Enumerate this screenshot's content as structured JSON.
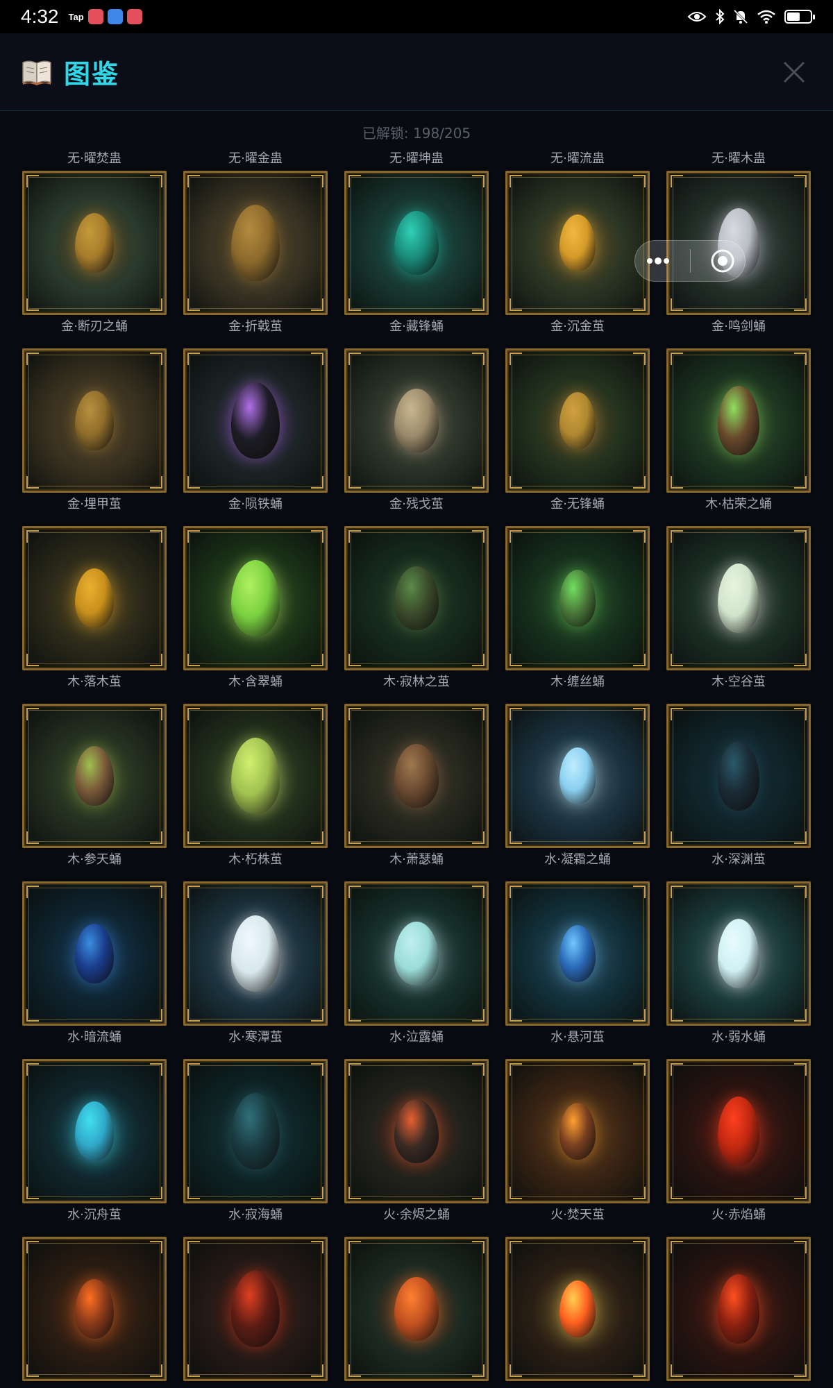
{
  "status_bar": {
    "time": "4:32",
    "tap_label": "Tap",
    "app_icon_colors": [
      "#e34f5a",
      "#3f86e8",
      "#e34f5a"
    ],
    "icons": [
      "eye-icon",
      "bluetooth-icon",
      "bell-muted-icon",
      "wifi-icon",
      "battery-icon"
    ]
  },
  "header": {
    "title": "图鉴",
    "icon": "book-icon",
    "close_icon": "close-icon"
  },
  "progress": {
    "text": "已解锁: 198/205"
  },
  "top_row_names": [
    "无·曜焚蛊",
    "无·曜金蛊",
    "无·曜坤蛊",
    "无·曜流蛊",
    "无·曜木蛊"
  ],
  "items": [
    {
      "name": "金·断刃之蛹",
      "bg": "#2a3a2c",
      "glow": "#c49a3a",
      "egg": "#a67c2c"
    },
    {
      "name": "金·折戟茧",
      "bg": "#3a3424",
      "glow": "#b48a40",
      "egg": "#8c6a2c"
    },
    {
      "name": "金·藏锋蛹",
      "bg": "#183830",
      "glow": "#2fd0b8",
      "egg": "#1a8a78"
    },
    {
      "name": "金·沉金茧",
      "bg": "#2c3624",
      "glow": "#f0b840",
      "egg": "#d49a28"
    },
    {
      "name": "金·鸣剑蛹",
      "bg": "#24302a",
      "glow": "#d8dce0",
      "egg": "#b8bcc4"
    },
    {
      "name": "金·埋甲茧",
      "bg": "#3a3220",
      "glow": "#b89040",
      "egg": "#8e6c2a"
    },
    {
      "name": "金·陨铁蛹",
      "bg": "#1c2426",
      "glow": "#b070e8",
      "egg": "#1c1c24"
    },
    {
      "name": "金·残戈茧",
      "bg": "#2a3428",
      "glow": "#c8b690",
      "egg": "#9a8a6a"
    },
    {
      "name": "金·无锋蛹",
      "bg": "#22321e",
      "glow": "#d0a040",
      "egg": "#b08830"
    },
    {
      "name": "木·枯荣之蛹",
      "bg": "#1c3420",
      "glow": "#8ee060",
      "egg": "#6a4a2c"
    },
    {
      "name": "木·落木茧",
      "bg": "#2c2a1a",
      "glow": "#e8b030",
      "egg": "#c8901c"
    },
    {
      "name": "木·含翠蛹",
      "bg": "#1c3418",
      "glow": "#b0f060",
      "egg": "#7ad040"
    },
    {
      "name": "木·寂林之茧",
      "bg": "#162a1c",
      "glow": "#5a8a4a",
      "egg": "#3a4a2a"
    },
    {
      "name": "木·缠丝蛹",
      "bg": "#16301c",
      "glow": "#70e060",
      "egg": "#4a7a3a"
    },
    {
      "name": "木·空谷茧",
      "bg": "#1c2e26",
      "glow": "#e8f4e0",
      "egg": "#d0e4cc"
    },
    {
      "name": "木·参天蛹",
      "bg": "#243020",
      "glow": "#a0c050",
      "egg": "#7a5a3a"
    },
    {
      "name": "木·朽株茧",
      "bg": "#22301c",
      "glow": "#d0f070",
      "egg": "#a0c050"
    },
    {
      "name": "木·萧瑟蛹",
      "bg": "#26281e",
      "glow": "#a07850",
      "egg": "#6a4a30"
    },
    {
      "name": "水·凝霜之蛹",
      "bg": "#1a3240",
      "glow": "#c0ecff",
      "egg": "#8ad0f0"
    },
    {
      "name": "水·深渊茧",
      "bg": "#10242a",
      "glow": "#2a5a6a",
      "egg": "#1a2a34"
    },
    {
      "name": "水·暗流蛹",
      "bg": "#0e2430",
      "glow": "#3a8ee0",
      "egg": "#1a3c8a"
    },
    {
      "name": "水·寒潭茧",
      "bg": "#1c3440",
      "glow": "#f0f8ff",
      "egg": "#d8e8ec"
    },
    {
      "name": "水·泣露蛹",
      "bg": "#16302a",
      "glow": "#c0f0f0",
      "egg": "#9adcd8"
    },
    {
      "name": "水·悬河茧",
      "bg": "#12303a",
      "glow": "#70c8ff",
      "egg": "#2a6ab8"
    },
    {
      "name": "水·弱水蛹",
      "bg": "#1a3a3a",
      "glow": "#e8fcff",
      "egg": "#d0f0f4"
    },
    {
      "name": "水·沉舟茧",
      "bg": "#10262c",
      "glow": "#40e0f0",
      "egg": "#30a8c8"
    },
    {
      "name": "水·寂海蛹",
      "bg": "#0e2426",
      "glow": "#30707a",
      "egg": "#1a3a40"
    },
    {
      "name": "火·余烬之蛹",
      "bg": "#22221c",
      "glow": "#e86030",
      "egg": "#3a2a24"
    },
    {
      "name": "火·焚天茧",
      "bg": "#3a2414",
      "glow": "#ffa030",
      "egg": "#7a4020"
    },
    {
      "name": "火·赤焰蛹",
      "bg": "#2a1410",
      "glow": "#ff4020",
      "egg": "#c02810"
    },
    {
      "name": "",
      "bg": "#2a1c12",
      "glow": "#ff7020",
      "egg": "#8a3a1a"
    },
    {
      "name": "",
      "bg": "#261a16",
      "glow": "#e04020",
      "egg": "#5a1c14"
    },
    {
      "name": "",
      "bg": "#1c2a22",
      "glow": "#ff8030",
      "egg": "#c05020"
    },
    {
      "name": "",
      "bg": "#2a1e14",
      "glow": "#ffd050",
      "egg": "#ff6020"
    },
    {
      "name": "",
      "bg": "#2a1410",
      "glow": "#ff5020",
      "egg": "#8a2010"
    }
  ],
  "capsule": {
    "more_icon": "more-dots-icon",
    "close_icon": "target-close-icon"
  }
}
